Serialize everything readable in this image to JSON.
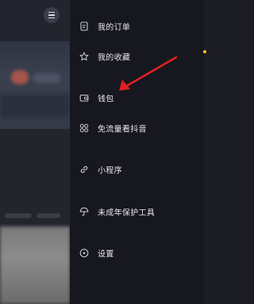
{
  "drawer": {
    "items": [
      {
        "label": "我的订单",
        "icon": "order-icon"
      },
      {
        "label": "我的收藏",
        "icon": "star-icon",
        "badge_color": "#f0c419"
      },
      {
        "label": "钱包",
        "icon": "wallet-icon"
      },
      {
        "label": "免流量看抖音",
        "icon": "grid-icon"
      },
      {
        "label": "小程序",
        "icon": "link-icon"
      },
      {
        "label": "未成年保护工具",
        "icon": "umbrella-icon"
      },
      {
        "label": "设置",
        "icon": "settings-icon"
      }
    ]
  },
  "annotation": {
    "arrow_color": "#e02020"
  },
  "colors": {
    "drawer_bg": "#16171f",
    "text": "#e8e8ec",
    "icon": "#c9c9cf"
  }
}
